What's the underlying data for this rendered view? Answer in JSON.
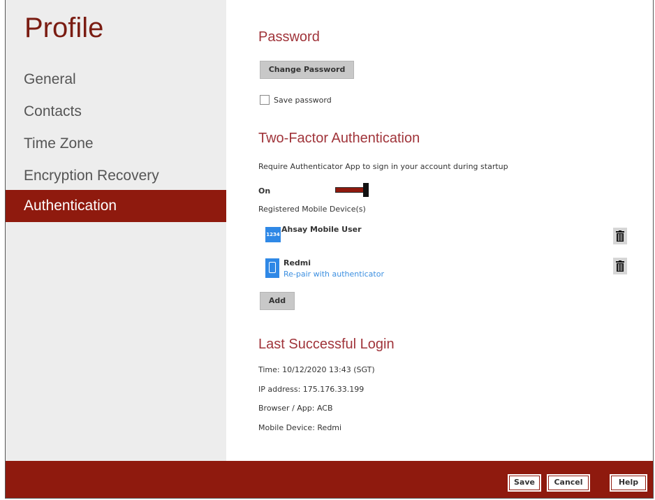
{
  "sidebar": {
    "title": "Profile",
    "items": [
      {
        "label": "General"
      },
      {
        "label": "Contacts"
      },
      {
        "label": "Time Zone"
      },
      {
        "label": "Encryption Recovery"
      },
      {
        "label": "Authentication"
      }
    ]
  },
  "password": {
    "title": "Password",
    "change_button": "Change Password",
    "save_checkbox_label": "Save password",
    "save_checked": false
  },
  "tfa": {
    "title": "Two-Factor Authentication",
    "description": "Require Authenticator App to sign in your account during startup",
    "toggle_label": "On",
    "toggle_on": true,
    "devices_label": "Registered Mobile Device(s)",
    "devices": [
      {
        "name": "Ahsay Mobile User",
        "icon": "1234",
        "icon_name": "code-icon"
      },
      {
        "name": "Redmi",
        "link": "Re-pair with authenticator",
        "icon_name": "phone-icon"
      }
    ],
    "add_button": "Add"
  },
  "last_login": {
    "title": "Last Successful Login",
    "time": "Time: 10/12/2020 13:43 (SGT)",
    "ip": "IP address: 175.176.33.199",
    "browser": "Browser / App: ACB",
    "mobile": "Mobile Device: Redmi"
  },
  "footer": {
    "save": "Save",
    "cancel": "Cancel",
    "help": "Help"
  },
  "colors": {
    "accent": "#8f1a0e",
    "title_red": "#a0343a",
    "link_blue": "#3c8fe0",
    "device_icon_blue": "#2f88e6"
  }
}
